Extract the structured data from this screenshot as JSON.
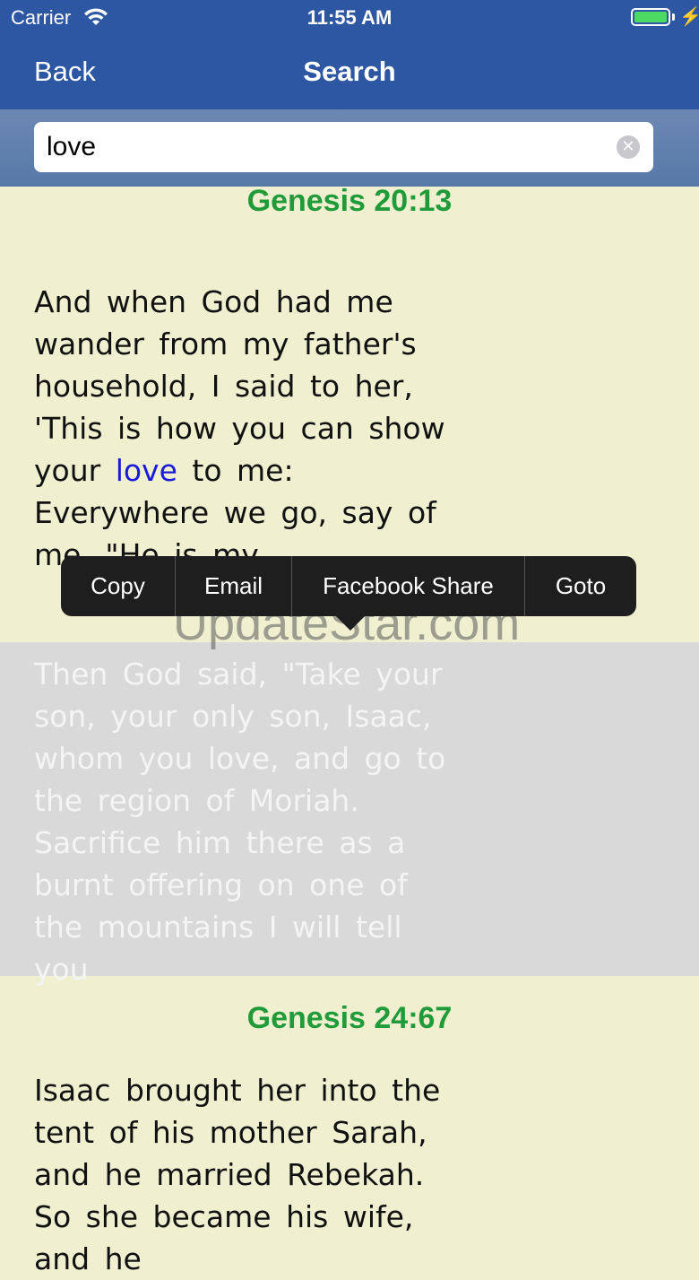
{
  "status": {
    "carrier": "Carrier",
    "time": "11:55 AM",
    "battery_color": "#4cd964"
  },
  "nav": {
    "back_label": "Back",
    "title": "Search"
  },
  "search": {
    "value": "love"
  },
  "results": [
    {
      "ref": "Genesis 20:13",
      "text_before": "And when God had me wander from my father's household, I said to her, 'This is how you can show your ",
      "highlight": "love",
      "text_after": " to me: Everywhere we go, say of me, \"He is my"
    },
    {
      "text": "Then God said, \"Take your son, your only son, Isaac, whom you love, and go to the region of Moriah. Sacrifice him there as a burnt offering on one of the mountains I will tell you"
    },
    {
      "ref": "Genesis 24:67",
      "text": "Isaac brought her into the tent of his mother Sarah, and he married Rebekah. So she became his wife, and he"
    }
  ],
  "context_menu": {
    "copy": "Copy",
    "email": "Email",
    "facebook_share": "Facebook Share",
    "goto": "Goto"
  },
  "watermark": "UpdateStar.com",
  "colors": {
    "nav_bg": "#2d57a3",
    "ref_green": "#1f9b39",
    "highlight_blue": "#1a1adb",
    "page_bg": "#f0efd0"
  }
}
